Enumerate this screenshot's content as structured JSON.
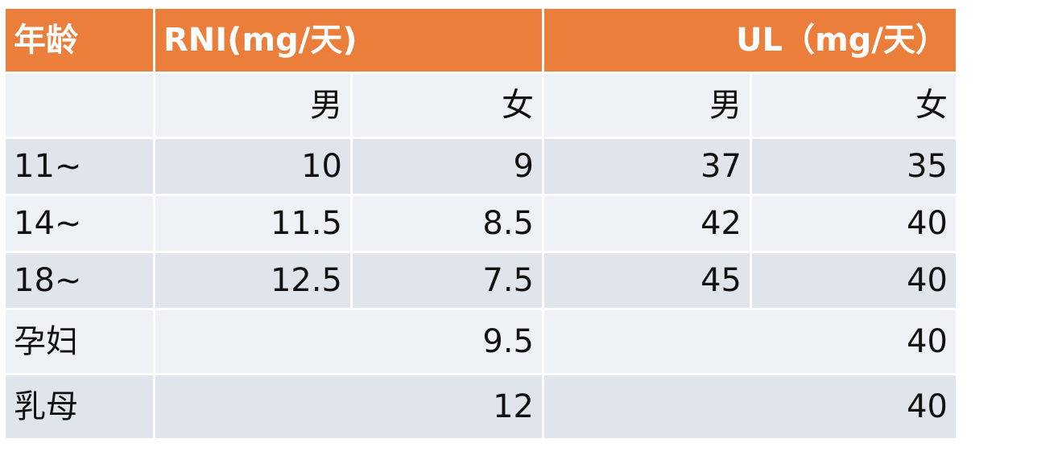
{
  "table": {
    "header": {
      "age": "年龄",
      "rni": "RNI(mg/天)",
      "ul": "UL（mg/天）"
    },
    "subheader": {
      "rni_male": "男",
      "rni_female": "女",
      "ul_male": "男",
      "ul_female": "女"
    },
    "rows": [
      {
        "age": "11~",
        "rni_male": "10",
        "rni_female": "9",
        "ul_male": "37",
        "ul_female": "35"
      },
      {
        "age": "14~",
        "rni_male": "11.5",
        "rni_female": "8.5",
        "ul_male": "42",
        "ul_female": "40"
      },
      {
        "age": "18~",
        "rni_male": "12.5",
        "rni_female": "7.5",
        "ul_male": "45",
        "ul_female": "40"
      }
    ],
    "special_rows": [
      {
        "age": "孕妇",
        "rni": "9.5",
        "ul": "40"
      },
      {
        "age": "乳母",
        "rni": "12",
        "ul": "40"
      }
    ],
    "colors": {
      "header_bg": "#ea7e3a",
      "header_text": "#ffffff",
      "row_dark": "#e0e5ec",
      "row_light": "#eef2f7"
    }
  }
}
